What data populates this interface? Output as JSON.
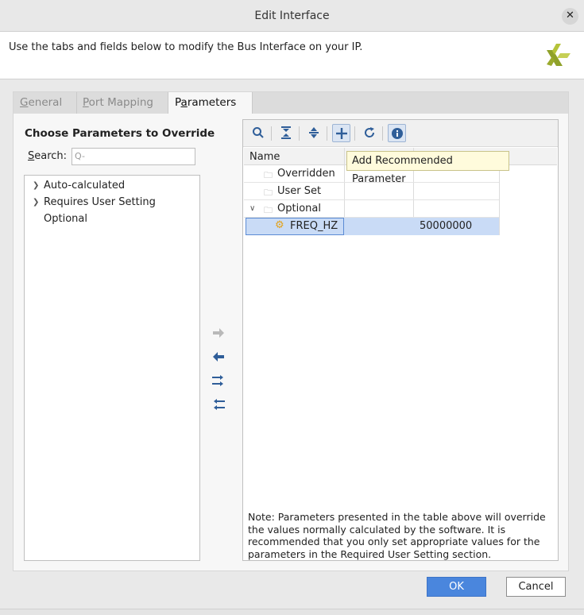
{
  "window": {
    "title": "Edit Interface",
    "close_glyph": "✕"
  },
  "header": {
    "description": "Use the tabs and fields below to modify the Bus Interface on your IP."
  },
  "tabs": [
    {
      "label_underlined": "G",
      "label_rest": "eneral",
      "active": false
    },
    {
      "label_underlined": "P",
      "label_rest": "ort Mapping",
      "active": false
    },
    {
      "label_prefix": "P",
      "label_underlined": "a",
      "label_rest": "rameters",
      "active": true
    }
  ],
  "left_panel": {
    "heading": "Choose Parameters to Override",
    "search_label_underlined": "S",
    "search_label_rest": "earch:",
    "search_placeholder": "Q-",
    "tree": [
      {
        "label": "Auto-calculated",
        "expandable": true
      },
      {
        "label": "Requires User Setting",
        "expandable": true
      },
      {
        "label": "Optional",
        "expandable": false
      }
    ]
  },
  "toolbar": {
    "buttons": [
      "search-icon",
      "collapse-all-icon",
      "expand-all-icon",
      "add-icon",
      "refresh-icon",
      "info-icon"
    ],
    "tooltip": "Add Recommended Parameter"
  },
  "grid": {
    "columns": [
      "Name"
    ],
    "rows": [
      {
        "label": "Overridden",
        "kind": "folder"
      },
      {
        "label": "User Set",
        "kind": "folder"
      },
      {
        "label": "Optional",
        "kind": "folder",
        "expanded": true
      }
    ],
    "selected": {
      "name": "FREQ_HZ",
      "value": "50000000"
    }
  },
  "note": "Note: Parameters presented in the table above will override the values normally calculated by the software. It is recommended that you only set appropriate values for the parameters in the Required User Setting section.",
  "footer": {
    "ok_label": "OK",
    "cancel_label": "Cancel"
  },
  "colors": {
    "accent": "#4a86dd",
    "selection": "#c9dbf6",
    "tooltip_bg": "#fffbdc"
  }
}
